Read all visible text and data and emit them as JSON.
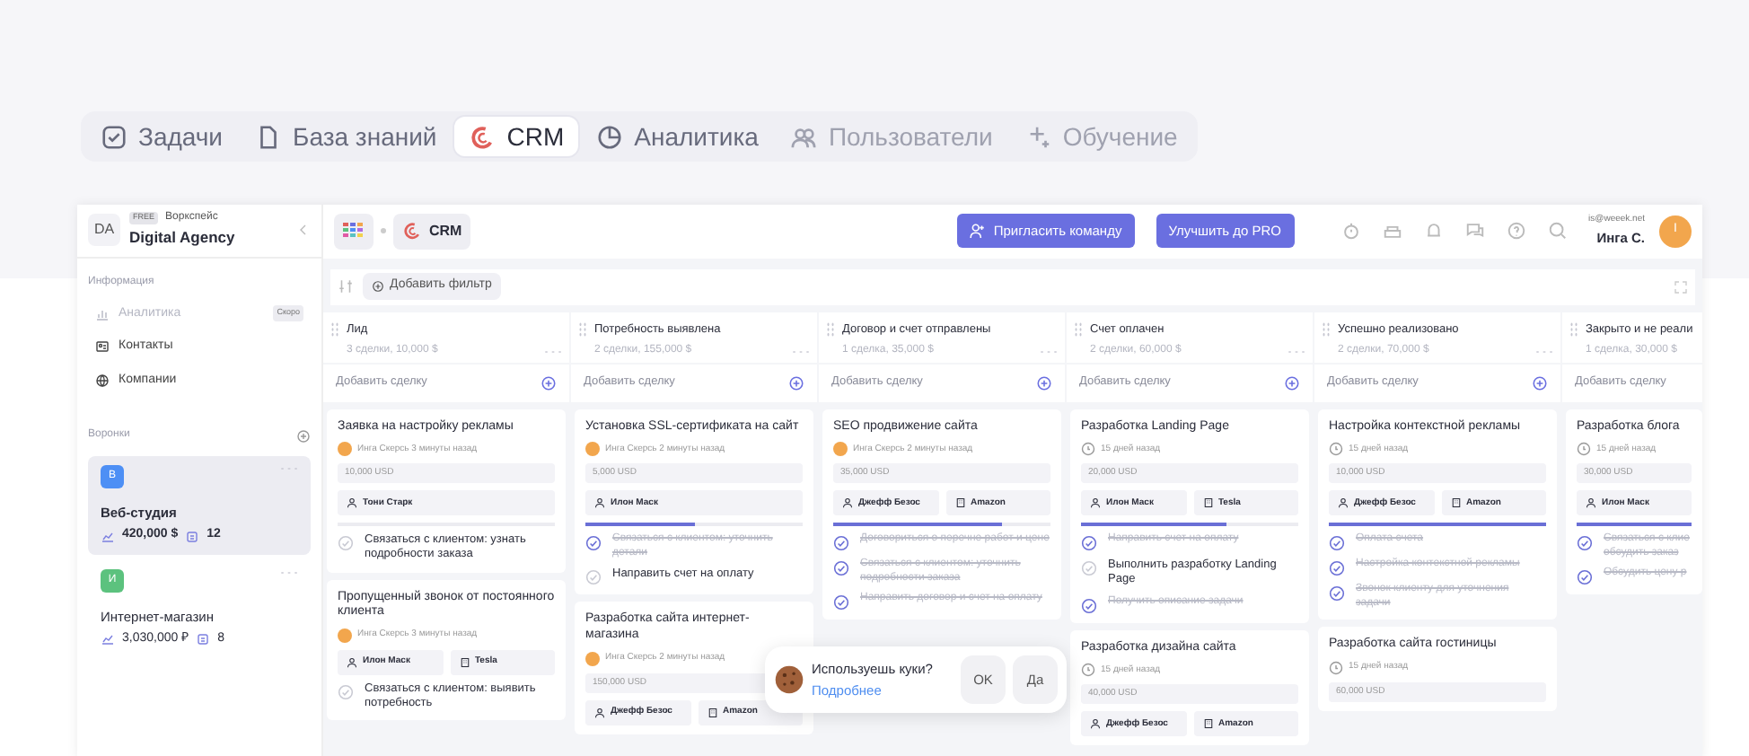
{
  "top_tabs": [
    {
      "label": "Задачи",
      "selected": false,
      "disabled": false
    },
    {
      "label": "База знаний",
      "selected": false,
      "disabled": false
    },
    {
      "label": "CRM",
      "selected": true,
      "disabled": false
    },
    {
      "label": "Аналитика",
      "selected": false,
      "disabled": false
    },
    {
      "label": "Пользователи",
      "selected": false,
      "disabled": true
    },
    {
      "label": "Обучение",
      "selected": false,
      "disabled": true
    }
  ],
  "sidebar": {
    "initials": "DA",
    "plan": "FREE",
    "workspace_label": "Воркспейс",
    "workspace": "Digital Agency",
    "info_heading": "Информация",
    "items": [
      {
        "label": "Аналитика",
        "disabled": true,
        "badge": "Скоро"
      },
      {
        "label": "Контакты",
        "disabled": false
      },
      {
        "label": "Компании",
        "disabled": false
      }
    ],
    "funnels_heading": "Воронки",
    "funnels": [
      {
        "letter": "В",
        "color": "#4d8ff5",
        "name": "Веб-студия",
        "amount": "420,000 $",
        "count": "12",
        "selected": true
      },
      {
        "letter": "И",
        "color": "#5cc27e",
        "name": "Интернет-магазин",
        "amount": "3,030,000 ₽",
        "count": "8",
        "selected": false
      }
    ]
  },
  "header": {
    "module": "CRM",
    "buttons": [
      "Пригласить команду",
      "Улучшить до PRO"
    ],
    "email": "is@weeek.net",
    "user": "Инга С.",
    "avatar": "I"
  },
  "filter": {
    "label": "Добавить фильтр"
  },
  "columns": [
    {
      "title": "Лид",
      "summary": "3 сделки, 10,000 $",
      "add_label": "Добавить сделку",
      "cards": [
        {
          "title": "Заявка на настройку рекламы",
          "kind": "author",
          "meta": "Инга Скерсь 3 минуты назад",
          "amount": "10,000 USD",
          "tags": [
            {
              "kind": "person",
              "text": "Тони Старк"
            }
          ],
          "level": 0,
          "tasks": [
            {
              "text": "Связаться с клиентом: узнать подробности заказа",
              "done": false
            }
          ]
        },
        {
          "title": "Пропущенный звонок от постоянного клиента",
          "kind": "author",
          "meta": "Инга Скерсь 3 минуты назад",
          "tags": [
            {
              "kind": "person",
              "text": "Илон Маск"
            },
            {
              "kind": "company",
              "text": "Tesla"
            }
          ],
          "tasks": [
            {
              "text": "Связаться с клиентом: выявить потребность",
              "done": false
            }
          ]
        }
      ]
    },
    {
      "title": "Потребность выявлена",
      "summary": "2 сделки, 155,000 $",
      "add_label": "Добавить сделку",
      "cards": [
        {
          "title": "Установка SSL-сертификата на сайт",
          "kind": "author",
          "meta": "Инга Скерсь 2 минуты назад",
          "amount": "5,000 USD",
          "tags": [
            {
              "kind": "person",
              "text": "Илон Маск"
            }
          ],
          "level": 0.5,
          "tasks": [
            {
              "text": "Связаться с клиентом: уточнить детали",
              "done": true
            },
            {
              "text": "Направить счет на оплату",
              "done": false
            }
          ]
        },
        {
          "title": "Разработка сайта интернет-магазина",
          "kind": "author",
          "meta": "Инга Скерсь 2 минуты назад",
          "amount": "150,000 USD",
          "tags": [
            {
              "kind": "person",
              "text": "Джефф Безос"
            },
            {
              "kind": "company",
              "text": "Amazon"
            }
          ]
        }
      ]
    },
    {
      "title": "Договор и счет отправлены",
      "summary": "1 сделка, 35,000 $",
      "add_label": "Добавить сделку",
      "cards": [
        {
          "title": "SEO продвижение сайта",
          "kind": "author",
          "meta": "Инга Скерсь 2 минуты назад",
          "amount": "35,000 USD",
          "tags": [
            {
              "kind": "person",
              "text": "Джефф Безос"
            },
            {
              "kind": "company",
              "text": "Amazon"
            }
          ],
          "level": 0.78,
          "tasks": [
            {
              "text": "Договориться о перечне работ и цене",
              "done": true
            },
            {
              "text": "Связаться с клиентом: уточнить подробности заказа",
              "done": true
            },
            {
              "text": "Направить договор и счет на оплату",
              "done": true
            }
          ]
        }
      ]
    },
    {
      "title": "Счет оплачен",
      "summary": "2 сделки, 60,000 $",
      "add_label": "Добавить сделку",
      "cards": [
        {
          "title": "Разработка Landing Page",
          "kind": "age",
          "meta": "15 дней назад",
          "amount": "20,000 USD",
          "tags": [
            {
              "kind": "person",
              "text": "Илон Маск"
            },
            {
              "kind": "company",
              "text": "Tesla"
            }
          ],
          "level": 0.67,
          "tasks": [
            {
              "text": "Направить счет на оплату",
              "done": true
            },
            {
              "text": "Выполнить разработку Landing Page",
              "done": false
            },
            {
              "text": "Получить описание задачи",
              "done": true
            }
          ]
        },
        {
          "title": "Разработка дизайна сайта",
          "kind": "age",
          "meta": "15 дней назад",
          "amount": "40,000 USD",
          "tags": [
            {
              "kind": "person",
              "text": "Джефф Безос"
            },
            {
              "kind": "company",
              "text": "Amazon"
            }
          ]
        }
      ]
    },
    {
      "title": "Успешно реализовано",
      "summary": "2 сделки, 70,000 $",
      "add_label": "Добавить сделку",
      "cards": [
        {
          "title": "Настройка контекстной рекламы",
          "kind": "age",
          "meta": "15 дней назад",
          "amount": "10,000 USD",
          "tags": [
            {
              "kind": "person",
              "text": "Джефф Безос"
            },
            {
              "kind": "company",
              "text": "Amazon"
            }
          ],
          "level": 1,
          "tasks": [
            {
              "text": "Оплата счета",
              "done": true
            },
            {
              "text": "Настройка контекстной рекламы",
              "done": true
            },
            {
              "text": "Звонок клиенту для уточнения задачи",
              "done": true
            }
          ]
        },
        {
          "title": "Разработка сайта гостиницы",
          "kind": "age",
          "meta": "15 дней назад",
          "amount": "60,000 USD"
        }
      ]
    },
    {
      "title": "Закрыто и не реали",
      "summary": "1 сделка, 30,000 $",
      "add_label": "Добавить сделку",
      "cards": [
        {
          "title": "Разработка блога",
          "kind": "age",
          "meta": "15 дней назад",
          "amount": "30,000 USD",
          "tags": [
            {
              "kind": "person",
              "text": "Илон Маск"
            }
          ],
          "level": 1,
          "tasks": [
            {
              "text": "Связаться с клие\nобсудить заказ",
              "done": true
            },
            {
              "text": "Обсудить цену р",
              "done": true
            }
          ]
        }
      ]
    }
  ],
  "cookie": {
    "question": "Используешь куки?",
    "link": "Подробнее",
    "buttons": [
      "OK",
      "Да"
    ]
  }
}
